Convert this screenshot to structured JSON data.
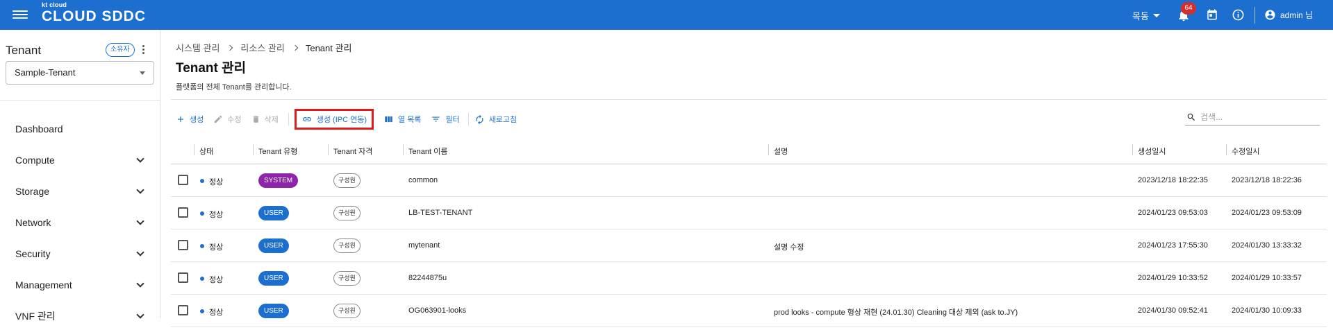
{
  "header": {
    "logo_small": "kt cloud",
    "logo_big": "CLOUD SDDC",
    "region": "목동",
    "notification_count": "64",
    "user": "admin 님",
    "colors": {
      "bar": "#1d6fcf",
      "badge": "#d32f2f"
    }
  },
  "sidebar": {
    "tenant_label": "Tenant",
    "owner_badge": "소유자",
    "selected_tenant": "Sample-Tenant",
    "items": [
      {
        "label": "Dashboard",
        "expandable": false
      },
      {
        "label": "Compute",
        "expandable": true
      },
      {
        "label": "Storage",
        "expandable": true
      },
      {
        "label": "Network",
        "expandable": true
      },
      {
        "label": "Security",
        "expandable": true
      },
      {
        "label": "Management",
        "expandable": true
      },
      {
        "label": "VNF 관리",
        "expandable": true
      }
    ]
  },
  "breadcrumb": [
    "시스템 관리",
    "리소스 관리",
    "Tenant 관리"
  ],
  "page": {
    "title": "Tenant 관리",
    "description": "플랫폼의 전체 Tenant를 관리합니다."
  },
  "toolbar": {
    "create": "생성",
    "edit": "수정",
    "delete": "삭제",
    "create_ipc": "생성 (IPC 연동)",
    "columns": "열 목록",
    "filter": "필터",
    "refresh": "새로고침",
    "search_placeholder": "검색..."
  },
  "table": {
    "headers": {
      "status": "상태",
      "type": "Tenant 유형",
      "role": "Tenant 자격",
      "name": "Tenant 이름",
      "desc": "설명",
      "created": "생성일시",
      "modified": "수정일시"
    },
    "rows": [
      {
        "status": "정상",
        "type": "SYSTEM",
        "type_color": "#8e24aa",
        "role": "구성원",
        "name": "common",
        "desc": "",
        "created": "2023/12/18 18:22:35",
        "modified": "2023/12/18 18:22:36"
      },
      {
        "status": "정상",
        "type": "USER",
        "type_color": "#1d6fcf",
        "role": "구성원",
        "name": "LB-TEST-TENANT",
        "desc": "",
        "created": "2024/01/23 09:53:03",
        "modified": "2024/01/23 09:53:09"
      },
      {
        "status": "정상",
        "type": "USER",
        "type_color": "#1d6fcf",
        "role": "구성원",
        "name": "mytenant",
        "desc": "설명 수정",
        "created": "2024/01/23 17:55:30",
        "modified": "2024/01/30 13:33:32"
      },
      {
        "status": "정상",
        "type": "USER",
        "type_color": "#1d6fcf",
        "role": "구성원",
        "name": "82244875u",
        "desc": "",
        "created": "2024/01/29 10:33:52",
        "modified": "2024/01/29 10:33:57"
      },
      {
        "status": "정상",
        "type": "USER",
        "type_color": "#1d6fcf",
        "role": "구성원",
        "name": "OG063901-looks",
        "desc": "prod looks - compute 형상 재현 (24.01.30) Cleaning 대상 제외 (ask to.JY)",
        "created": "2024/01/30 09:52:41",
        "modified": "2024/01/30 10:09:33"
      }
    ]
  }
}
